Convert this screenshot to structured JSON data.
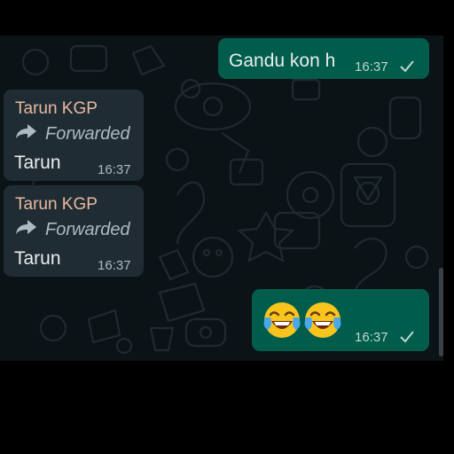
{
  "messages": [
    {
      "direction": "outgoing",
      "text": "Gandu kon h",
      "time": "16:37",
      "status": "sent-check-icon"
    },
    {
      "direction": "incoming",
      "sender": "Tarun KGP",
      "forwarded_label": "Forwarded",
      "text": "Tarun",
      "time": "16:37"
    },
    {
      "direction": "incoming",
      "sender": "Tarun KGP",
      "forwarded_label": "Forwarded",
      "text": "Tarun",
      "time": "16:37"
    },
    {
      "direction": "outgoing",
      "emojis": [
        "face-with-tears-of-joy",
        "face-with-tears-of-joy"
      ],
      "time": "16:37",
      "status": "sent-check-icon"
    }
  ],
  "colors": {
    "chat_background": "#0c1317",
    "outgoing_bubble": "#005c4b",
    "incoming_bubble": "#202c33",
    "sender_name": "#e8b9a0"
  }
}
